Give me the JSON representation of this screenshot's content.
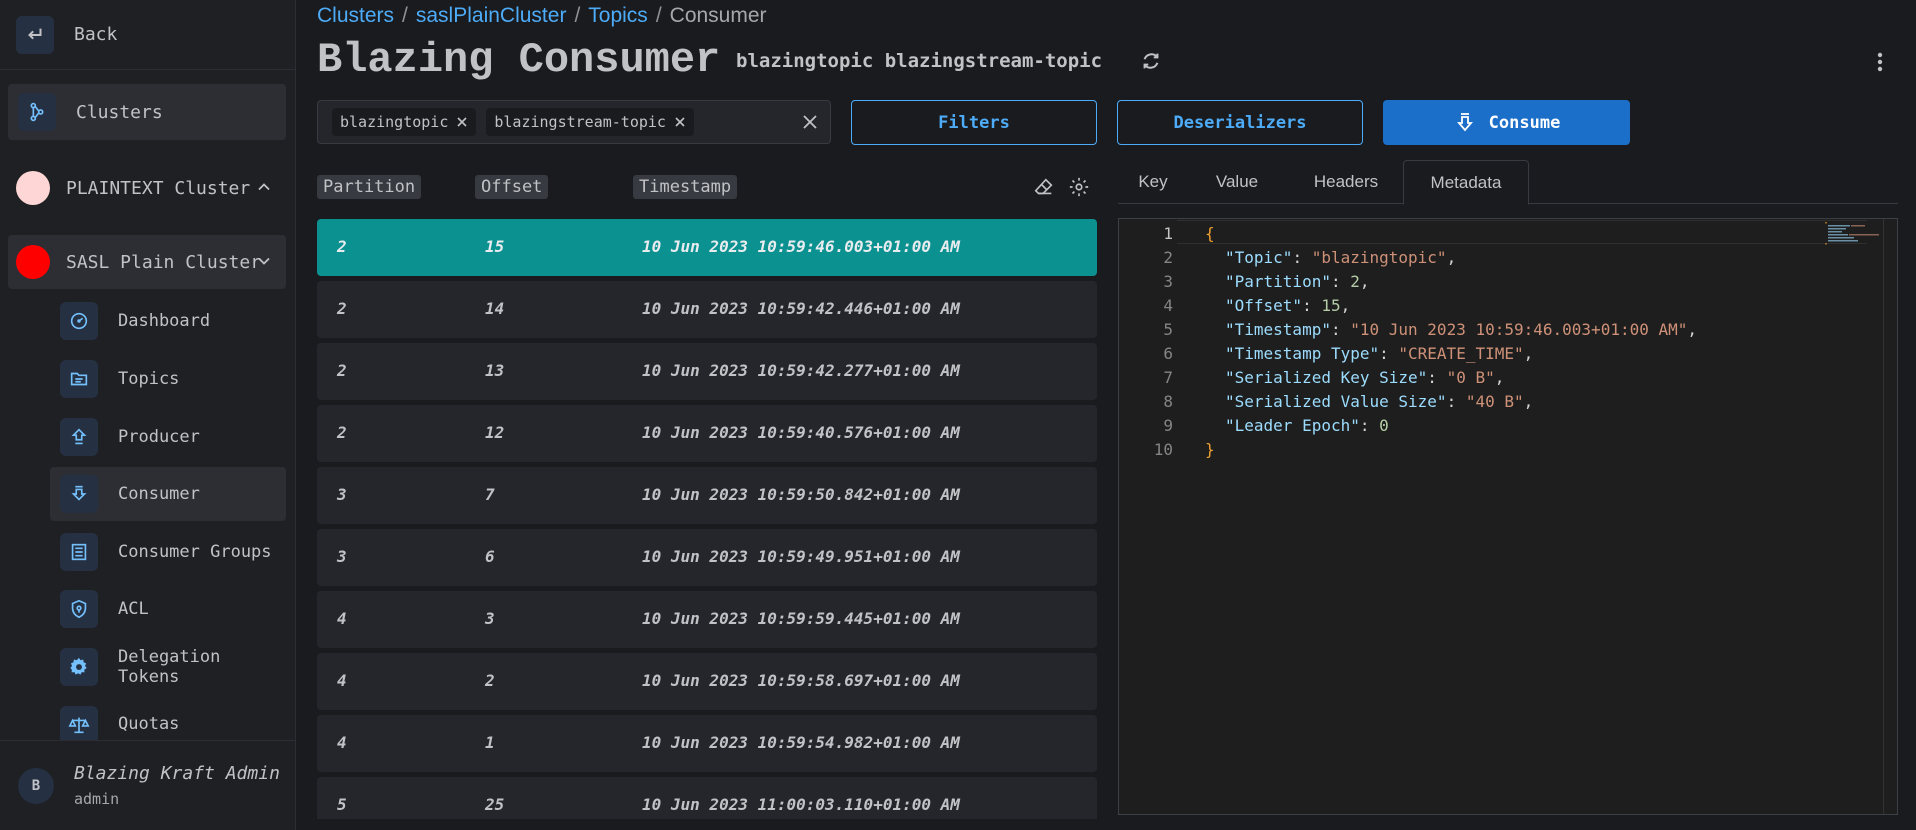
{
  "sidebar": {
    "back_label": "Back",
    "clusters_label": "Clusters",
    "clusters": [
      {
        "name": "PLAINTEXT Cluster",
        "color": "#ffd6d6",
        "expanded": false
      },
      {
        "name": "SASL Plain Cluster",
        "color": "#ff0000",
        "expanded": true
      }
    ],
    "items": [
      {
        "label": "Dashboard",
        "icon": "gauge-icon"
      },
      {
        "label": "Topics",
        "icon": "folder-icon"
      },
      {
        "label": "Producer",
        "icon": "upload-icon"
      },
      {
        "label": "Consumer",
        "icon": "download-icon",
        "active": true
      },
      {
        "label": "Consumer Groups",
        "icon": "groups-icon"
      },
      {
        "label": "ACL",
        "icon": "shield-icon"
      },
      {
        "label_line1": "Delegation",
        "label_line2": "Tokens",
        "icon": "gear-icon"
      },
      {
        "label": "Quotas",
        "icon": "scale-icon"
      }
    ],
    "user": {
      "initial": "B",
      "name": "Blazing Kraft Admin",
      "role": "admin"
    }
  },
  "breadcrumb": {
    "items": [
      "Clusters",
      "saslPlainCluster",
      "Topics"
    ],
    "separator": "/",
    "current": "Consumer"
  },
  "header": {
    "title": "Blazing Consumer",
    "topics_text": "blazingtopic blazingstream-topic"
  },
  "topic_select": {
    "chips": [
      "blazingtopic",
      "blazingstream-topic"
    ]
  },
  "buttons": {
    "filters": "Filters",
    "deserializers": "Deserializers",
    "consume": "Consume"
  },
  "table": {
    "columns": [
      "Partition",
      "Offset",
      "Timestamp"
    ],
    "rows": [
      {
        "partition": "2",
        "offset": "15",
        "timestamp": "10 Jun 2023 10:59:46.003+01:00 AM",
        "selected": true
      },
      {
        "partition": "2",
        "offset": "14",
        "timestamp": "10 Jun 2023 10:59:42.446+01:00 AM"
      },
      {
        "partition": "2",
        "offset": "13",
        "timestamp": "10 Jun 2023 10:59:42.277+01:00 AM"
      },
      {
        "partition": "2",
        "offset": "12",
        "timestamp": "10 Jun 2023 10:59:40.576+01:00 AM"
      },
      {
        "partition": "3",
        "offset": "7",
        "timestamp": "10 Jun 2023 10:59:50.842+01:00 AM"
      },
      {
        "partition": "3",
        "offset": "6",
        "timestamp": "10 Jun 2023 10:59:49.951+01:00 AM"
      },
      {
        "partition": "4",
        "offset": "3",
        "timestamp": "10 Jun 2023 10:59:59.445+01:00 AM"
      },
      {
        "partition": "4",
        "offset": "2",
        "timestamp": "10 Jun 2023 10:59:58.697+01:00 AM"
      },
      {
        "partition": "4",
        "offset": "1",
        "timestamp": "10 Jun 2023 10:59:54.982+01:00 AM"
      },
      {
        "partition": "5",
        "offset": "25",
        "timestamp": "10 Jun 2023 11:00:03.110+01:00 AM"
      }
    ]
  },
  "tabs": {
    "items": [
      "Key",
      "Value",
      "Headers",
      "Metadata"
    ],
    "active": "Metadata"
  },
  "editor": {
    "lines": [
      {
        "n": "1",
        "open": "{"
      },
      {
        "n": "2",
        "key": "\"Topic\"",
        "str": "\"blazingtopic\"",
        "comma": ","
      },
      {
        "n": "3",
        "key": "\"Partition\"",
        "num": "2",
        "comma": ","
      },
      {
        "n": "4",
        "key": "\"Offset\"",
        "num": "15",
        "comma": ","
      },
      {
        "n": "5",
        "key": "\"Timestamp\"",
        "str": "\"10 Jun 2023 10:59:46.003+01:00 AM\"",
        "comma": ","
      },
      {
        "n": "6",
        "key": "\"Timestamp Type\"",
        "str": "\"CREATE_TIME\"",
        "comma": ","
      },
      {
        "n": "7",
        "key": "\"Serialized Key Size\"",
        "str": "\"0 B\"",
        "comma": ","
      },
      {
        "n": "8",
        "key": "\"Serialized Value Size\"",
        "str": "\"40 B\"",
        "comma": ","
      },
      {
        "n": "9",
        "key": "\"Leader Epoch\"",
        "num": "0",
        "comma": ""
      },
      {
        "n": "10",
        "close": "}"
      }
    ]
  },
  "colors": {
    "accent": "#4dabf7",
    "selected_row": "#0c9191",
    "primary_button": "#1c6fc9"
  }
}
